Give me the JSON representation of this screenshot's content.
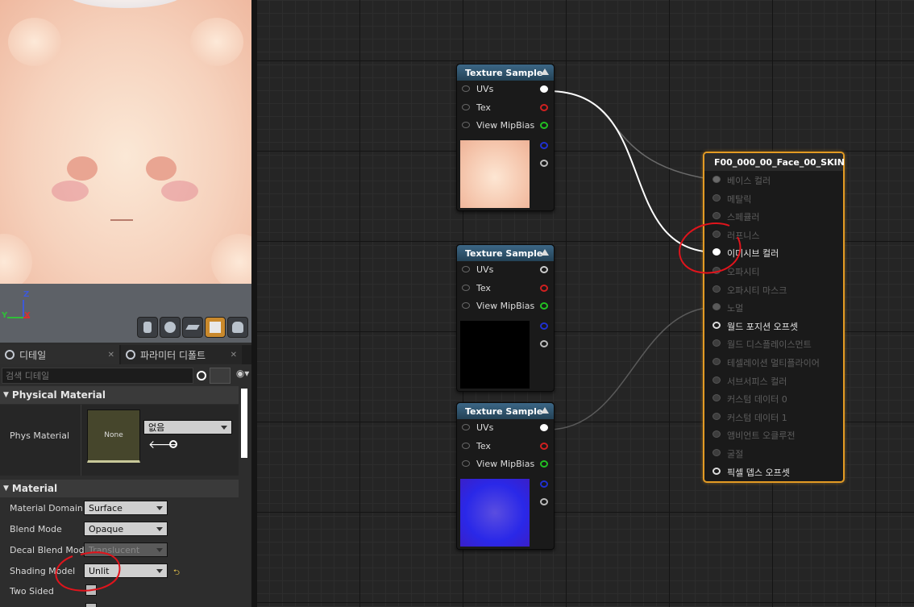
{
  "viewport": {
    "axis_z": "Z",
    "axis_y": "Y",
    "axis_x": "X",
    "buttons": [
      "cylinder-icon",
      "sphere-icon",
      "plane-icon",
      "cube-icon",
      "teapot-icon"
    ]
  },
  "details": {
    "tab_details": "디테일",
    "tab_params": "파라미터 디폴트",
    "search_placeholder": "검색 디테일",
    "physical_section": "Physical Material",
    "phys_material_label": "Phys Material",
    "phys_thumb_text": "None",
    "phys_combo_value": "없음",
    "material_section": "Material",
    "properties": [
      {
        "label": "Material Domain",
        "value": "Surface"
      },
      {
        "label": "Blend Mode",
        "value": "Opaque"
      },
      {
        "label": "Decal Blend Mode",
        "value": "Translucent"
      },
      {
        "label": "Shading Model",
        "value": "Unlit"
      },
      {
        "label": "Two Sided",
        "value": ""
      }
    ]
  },
  "graph": {
    "texture_nodes": [
      {
        "title": "Texture Sample",
        "pins": [
          "UVs",
          "Tex",
          "View MipBias"
        ]
      },
      {
        "title": "Texture Sample",
        "pins": [
          "UVs",
          "Tex",
          "View MipBias"
        ]
      },
      {
        "title": "Texture Sample",
        "pins": [
          "UVs",
          "Tex",
          "View MipBias"
        ]
      }
    ],
    "material_node": {
      "title": "F00_000_00_Face_00_SKIN",
      "inputs": [
        "베이스 컬러",
        "메탈릭",
        "스페큘러",
        "러프니스",
        "이미시브 컬러",
        "오파시티",
        "오파시티 마스크",
        "노멀",
        "월드 포지션 오프셋",
        "월드 디스플레이스먼트",
        "테셀레이션 멀티플라이어",
        "서브서피스 컬러",
        "커스텀 데이터 0",
        "커스텀 데이터 1",
        "앰비언트 오클루전",
        "굴절",
        "픽셀 뎁스 오프셋"
      ]
    },
    "colors": {
      "accent": "#e39b24",
      "header": "#2f5470",
      "annotation": "#e0141c"
    }
  }
}
